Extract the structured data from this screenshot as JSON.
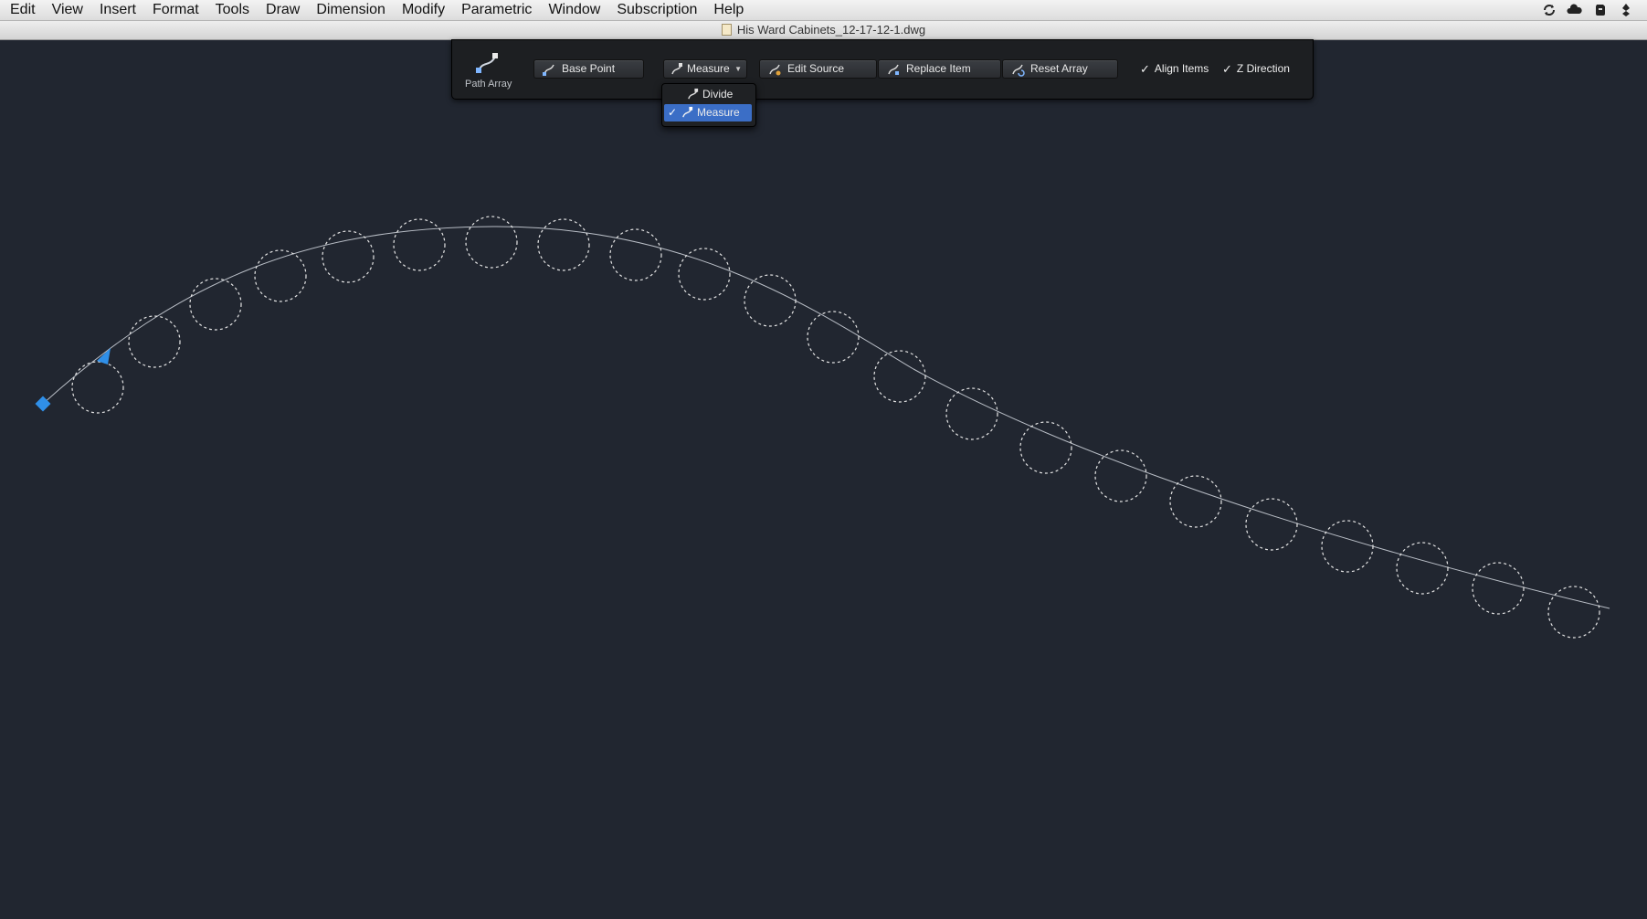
{
  "menu": {
    "items": [
      "Edit",
      "View",
      "Insert",
      "Format",
      "Tools",
      "Draw",
      "Dimension",
      "Modify",
      "Parametric",
      "Window",
      "Subscription",
      "Help"
    ]
  },
  "status_icons": [
    "sync-icon",
    "cloud-icon",
    "evernote-icon",
    "dropbox-icon"
  ],
  "window": {
    "title": "His Ward Cabinets_12-17-12-1.dwg"
  },
  "ribbon": {
    "path_array_label": "Path Array",
    "base_point": "Base Point",
    "method": "Measure",
    "edit_source": "Edit Source",
    "replace_item": "Replace Item",
    "reset_array": "Reset Array",
    "align_items": {
      "label": "Align Items",
      "checked": true
    },
    "z_direction": {
      "label": "Z Direction",
      "checked": true
    }
  },
  "dropdown": {
    "options": [
      {
        "label": "Divide",
        "selected": false
      },
      {
        "label": "Measure",
        "selected": true
      }
    ]
  },
  "colors": {
    "canvas_bg": "#212630",
    "grip": "#2f8fe8",
    "highlight": "#3b6ec6"
  }
}
